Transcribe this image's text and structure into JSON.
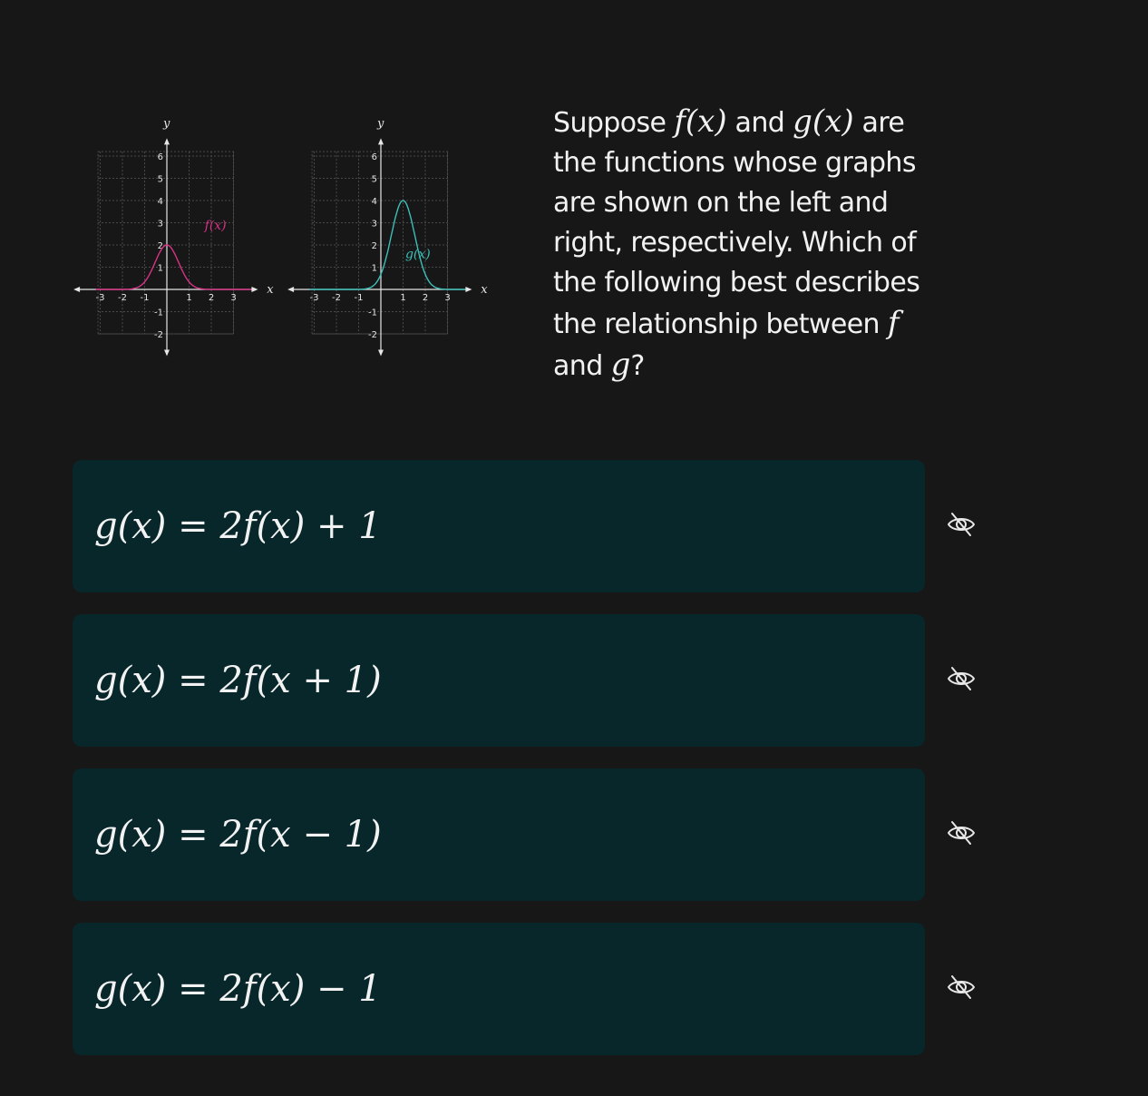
{
  "question": {
    "t1": "Suppose ",
    "f_of_x": "f(x)",
    "t2": " and ",
    "g_of_x": "g(x)",
    "t3": " are the functions whose graphs are shown on the left and right, respectively. Which of the following best describes the relationship between ",
    "f": "f",
    "t4": " and ",
    "g": "g",
    "t5": "?"
  },
  "graphs": {
    "left": {
      "curve_label": "f(x)",
      "curve_color": "#d63384",
      "axis_x_name": "x",
      "axis_y_name": "y",
      "x_ticks": [
        "-3",
        "-2",
        "-1",
        "1",
        "2",
        "3"
      ],
      "y_ticks": [
        "6",
        "5",
        "4",
        "3",
        "2",
        "1",
        "-1",
        "-2"
      ]
    },
    "right": {
      "curve_label": "g(x)",
      "curve_color": "#3cbfb8",
      "axis_x_name": "x",
      "axis_y_name": "y",
      "x_ticks": [
        "-3",
        "-2",
        "-1",
        "1",
        "2",
        "3"
      ],
      "y_ticks": [
        "6",
        "5",
        "4",
        "3",
        "2",
        "1",
        "-1",
        "-2"
      ]
    }
  },
  "choices": [
    {
      "formula": "g(x) = 2f(x) + 1",
      "icon": "eye-off-icon"
    },
    {
      "formula": "g(x) = 2f(x + 1)",
      "icon": "eye-off-icon"
    },
    {
      "formula": "g(x) = 2f(x − 1)",
      "icon": "eye-off-icon"
    },
    {
      "formula": "g(x) = 2f(x) − 1",
      "icon": "eye-off-icon"
    }
  ],
  "colors": {
    "background": "#171717",
    "card": "#08272b",
    "text": "#f2f2f2"
  }
}
